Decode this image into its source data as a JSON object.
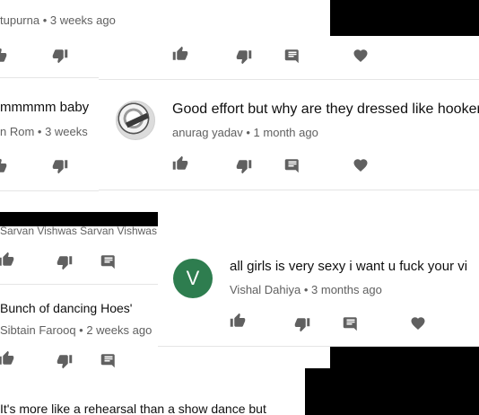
{
  "comments_back": [
    {
      "text": "",
      "meta": "tupurna • 3 weeks ago"
    },
    {
      "text": "mmmmm baby",
      "meta": "n Rom • 3 weeks"
    },
    {
      "text": "",
      "meta": "Sarvan Vishwas Sarvan Vishwas"
    },
    {
      "text": "Bunch of dancing Hoes'",
      "meta": "Sibtain Farooq • 2 weeks ago"
    },
    {
      "text": "It's more  like a rehearsal than a show dance but",
      "meta": ""
    }
  ],
  "comments_mid": [
    {
      "text": "Good effort but why are they dressed like hooker",
      "meta": "anurag yadav • 1 month ago",
      "avatar": "profile-photo"
    }
  ],
  "comments_front": [
    {
      "text": "all girls is very sexy i want u fuck your vi",
      "meta": "Vishal Dahiya • 3 months ago",
      "avatar_letter": "V",
      "avatar_color": "#2e7d4f"
    }
  ],
  "icons": {
    "like": "thumbs-up-icon",
    "dislike": "thumbs-down-icon",
    "reply": "comment-icon",
    "heart": "heart-icon"
  },
  "colors": {
    "primary_text": "#0f0f0f",
    "secondary_text": "#606060",
    "icon": "#606060",
    "divider": "#e5e5e5"
  }
}
